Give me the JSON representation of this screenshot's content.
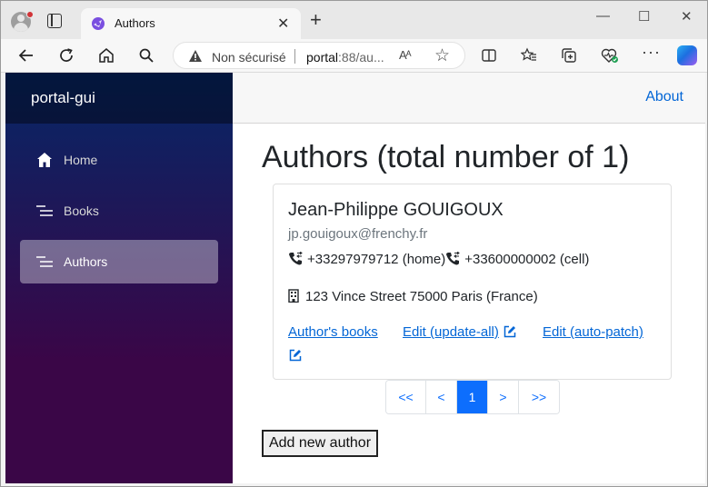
{
  "browser": {
    "tab_title": "Authors",
    "not_secure": "Non sécurisé",
    "url_host": "portal",
    "url_rest": ":88/au...",
    "read_aloud": "Aᴬ",
    "tab_close": "✕",
    "new_tab": "+",
    "win_minimize": "—",
    "win_maximize": "☐",
    "win_close": "✕"
  },
  "sidebar": {
    "brand": "portal-gui",
    "items": [
      {
        "label": "Home",
        "icon": "home-icon"
      },
      {
        "label": "Books",
        "icon": "list-icon"
      },
      {
        "label": "Authors",
        "icon": "list-icon",
        "active": true
      }
    ]
  },
  "top_row": {
    "about": "About"
  },
  "main": {
    "title": "Authors (total number of 1)",
    "author": {
      "name": "Jean-Philippe GOUIGOUX",
      "email": "jp.gouigoux@frenchy.fr",
      "phones": [
        "+33297979712 (home)",
        "+33600000002 (cell)"
      ],
      "address": "123 Vince Street 75000 Paris (France)",
      "links": {
        "books": "Author's books",
        "edit_update_all": "Edit (update-all)",
        "edit_auto_patch": "Edit (auto-patch)"
      }
    },
    "pagination": [
      "<<",
      "<",
      "1",
      ">",
      ">>"
    ],
    "current_page": "1",
    "add_button": "Add new author"
  },
  "colors": {
    "link": "#0366d6",
    "pagination_active": "#0d6efd",
    "sidebar_top": "#052767",
    "sidebar_bottom": "#3a0647"
  }
}
